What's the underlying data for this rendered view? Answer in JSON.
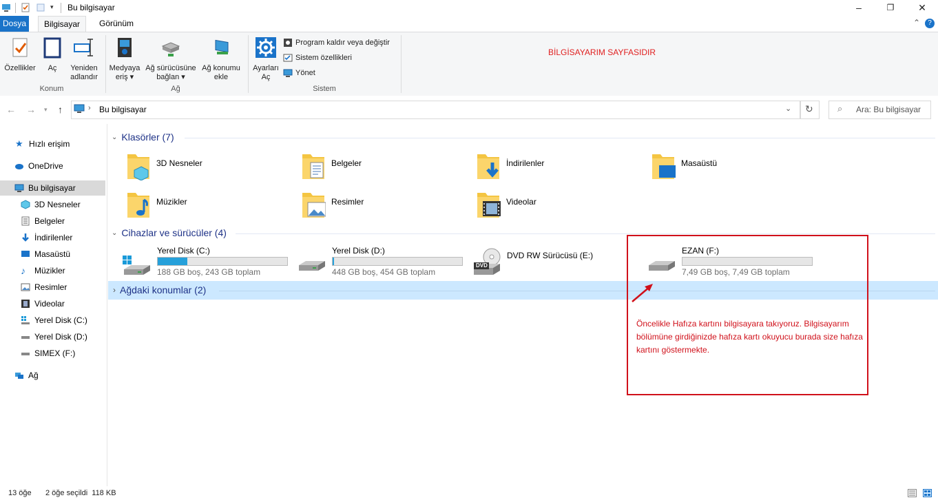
{
  "window": {
    "title": "Bu bilgisayar"
  },
  "ribbon": {
    "tabs": {
      "file": "Dosya",
      "computer": "Bilgisayar",
      "view": "Görünüm"
    },
    "groups": {
      "location": {
        "label": "Konum",
        "properties": "Özellikler",
        "open": "Aç",
        "rename_line1": "Yeniden",
        "rename_line2": "adlandır"
      },
      "network": {
        "label": "Ağ",
        "media_line1": "Medyaya",
        "media_line2": "eriş",
        "map_line1": "Ağ sürücüsüne",
        "map_line2": "bağlan",
        "add_line1": "Ağ konumu",
        "add_line2": "ekle"
      },
      "system": {
        "label": "Sistem",
        "settings_line1": "Ayarları",
        "settings_line2": "Aç",
        "uninstall": "Program kaldır veya değiştir",
        "sysprops": "Sistem özellikleri",
        "manage": "Yönet"
      }
    },
    "note": "BİLGİSAYARIM SAYFASIDIR"
  },
  "address": {
    "path": "Bu bilgisayar",
    "search_placeholder": "Ara: Bu bilgisayar"
  },
  "sidebar": {
    "items": [
      {
        "label": "Hızlı erişim"
      },
      {
        "label": "OneDrive"
      },
      {
        "label": "Bu bilgisayar"
      },
      {
        "label": "3D Nesneler"
      },
      {
        "label": "Belgeler"
      },
      {
        "label": "İndirilenler"
      },
      {
        "label": "Masaüstü"
      },
      {
        "label": "Müzikler"
      },
      {
        "label": "Resimler"
      },
      {
        "label": "Videolar"
      },
      {
        "label": "Yerel Disk (C:)"
      },
      {
        "label": "Yerel Disk (D:)"
      },
      {
        "label": "SIMEX (F:)"
      },
      {
        "label": "Ağ"
      }
    ]
  },
  "sections": {
    "folders": "Klasörler (7)",
    "devices": "Cihazlar ve sürücüler (4)",
    "network": "Ağdaki konumlar (2)"
  },
  "folders": [
    {
      "name": "3D Nesneler"
    },
    {
      "name": "Belgeler"
    },
    {
      "name": "İndirilenler"
    },
    {
      "name": "Masaüstü"
    },
    {
      "name": "Müzikler"
    },
    {
      "name": "Resimler"
    },
    {
      "name": "Videolar"
    }
  ],
  "drives": [
    {
      "name": "Yerel Disk (C:)",
      "detail": "188 GB boş, 243 GB toplam",
      "used_fraction": 0.23
    },
    {
      "name": "Yerel Disk (D:)",
      "detail": "448 GB boş, 454 GB toplam",
      "used_fraction": 0.01
    },
    {
      "name": "DVD RW Sürücüsü (E:)",
      "dvd_label": "DVD"
    },
    {
      "name": "EZAN (F:)",
      "detail": "7,49 GB boş, 7,49 GB toplam",
      "used_fraction": 0.0
    }
  ],
  "annotation": {
    "text": "Öncelikle Hafıza kartını bilgisayara takıyoruz. Bilgisayarım bölümüne girdiğinizde hafıza kartı okuyucu burada size hafıza kartını göstermekte."
  },
  "status": {
    "count": "13 öğe",
    "selection": "2 öğe seçildi  118 KB"
  },
  "colors": {
    "accent": "#1a73c9",
    "annotation": "#d0101a",
    "drive_fill": "#26a0da",
    "selection": "#cce8ff"
  }
}
